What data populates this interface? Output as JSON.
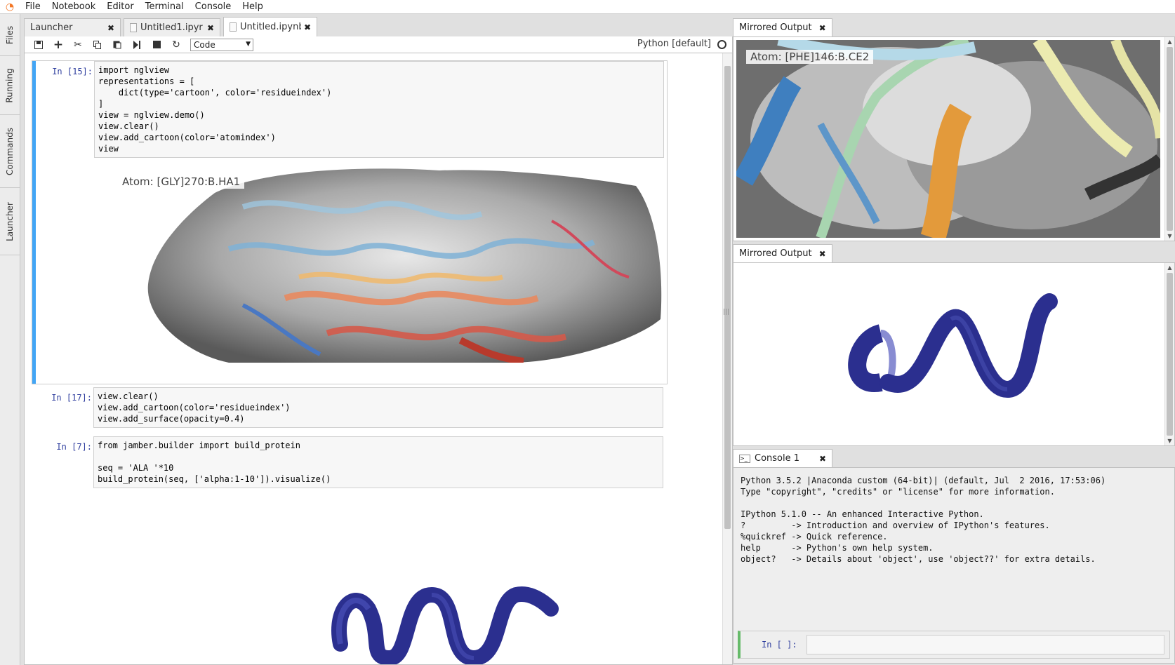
{
  "menubar": {
    "logo": "jupyter-logo",
    "items": [
      "File",
      "Notebook",
      "Editor",
      "Terminal",
      "Console",
      "Help"
    ]
  },
  "sidebar": {
    "tabs": [
      "Files",
      "Running",
      "Commands",
      "Launcher"
    ]
  },
  "notebook": {
    "tabs": [
      {
        "label": "Launcher",
        "icon": ""
      },
      {
        "label": "Untitled1.ipyr",
        "icon": "notebook-file-icon"
      },
      {
        "label": "Untitled.ipynb",
        "icon": "notebook-file-icon"
      }
    ],
    "toolbar": {
      "cell_type": "Code",
      "kernel": "Python [default]"
    },
    "cells": [
      {
        "prompt": "In [15]:",
        "source": "import nglview\nrepresentations = [\n    dict(type='cartoon', color='residueindex')\n]\nview = nglview.demo()\nview.clear()\nview.add_cartoon(color='atomindex')\nview",
        "output_label": "Atom: [GLY]270:B.HA1"
      },
      {
        "prompt": "In [17]:",
        "source": "view.clear()\nview.add_cartoon(color='residueindex')\nview.add_surface(opacity=0.4)"
      },
      {
        "prompt": "In [7]:",
        "source": "from jamber.builder import build_protein\n\nseq = 'ALA '*10\nbuild_protein(seq, ['alpha:1-10']).visualize()"
      }
    ]
  },
  "mirror1": {
    "title": "Mirrored Output",
    "atom_label": "Atom: [PHE]146:B.CE2"
  },
  "mirror2": {
    "title": "Mirrored Output"
  },
  "console": {
    "title": "Console 1",
    "banner": "Python 3.5.2 |Anaconda custom (64-bit)| (default, Jul  2 2016, 17:53:06)\nType \"copyright\", \"credits\" or \"license\" for more information.\n\nIPython 5.1.0 -- An enhanced Interactive Python.\n?         -> Introduction and overview of IPython's features.\n%quickref -> Quick reference.\nhelp      -> Python's own help system.\nobject?   -> Details about 'object', use 'object??' for extra details.",
    "input_prompt": "In [ ]:"
  },
  "colors": {
    "accent": "#42a5f5",
    "prompt": "#303f9f",
    "console_active": "#66bb6a",
    "helix": "#2b2f8f"
  }
}
